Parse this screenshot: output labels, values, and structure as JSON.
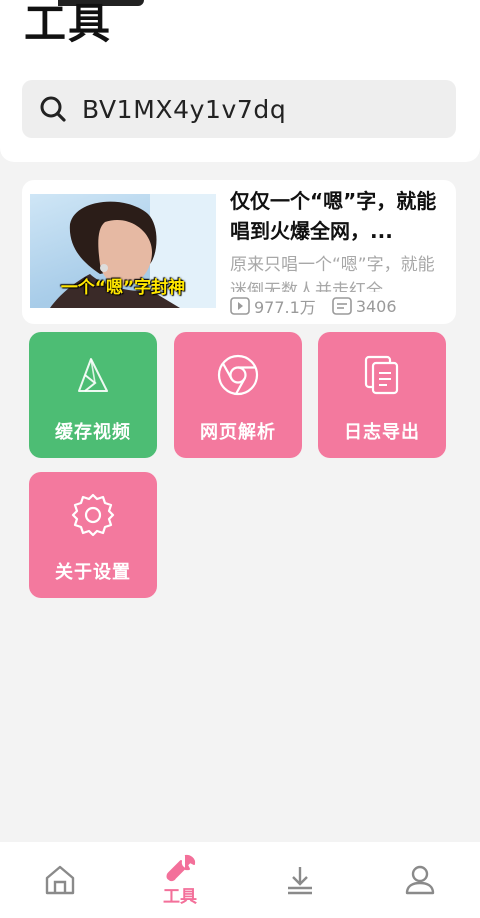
{
  "header": {
    "title": "工具"
  },
  "search": {
    "value": "BV1MX4y1v7dq"
  },
  "video": {
    "thumbnail_caption": "一个“嗯”字封神",
    "title": "仅仅一个“嗯”字，就能唱到火爆全网，...",
    "description": "原来只唱一个“嗯”字，就能迷倒无数人并走红全",
    "views": "977.1万",
    "comments": "3406"
  },
  "tools": [
    {
      "label": "缓存视频",
      "icon": "cache-icon",
      "color": "#4dbd74"
    },
    {
      "label": "网页解析",
      "icon": "chrome-icon",
      "color": "#f3799e"
    },
    {
      "label": "日志导出",
      "icon": "copy-document-icon",
      "color": "#f3799e"
    },
    {
      "label": "关于设置",
      "icon": "gear-icon",
      "color": "#f3799e"
    }
  ],
  "bottom_nav": {
    "items": [
      {
        "name": "home",
        "icon": "home-icon"
      },
      {
        "name": "tools",
        "icon": "wrench-icon",
        "label": "工具",
        "active": true
      },
      {
        "name": "download",
        "icon": "download-icon"
      },
      {
        "name": "profile",
        "icon": "user-icon"
      }
    ]
  },
  "colors": {
    "accent": "#f3709a",
    "tile_green": "#4dbd74",
    "tile_pink": "#f3799e"
  }
}
